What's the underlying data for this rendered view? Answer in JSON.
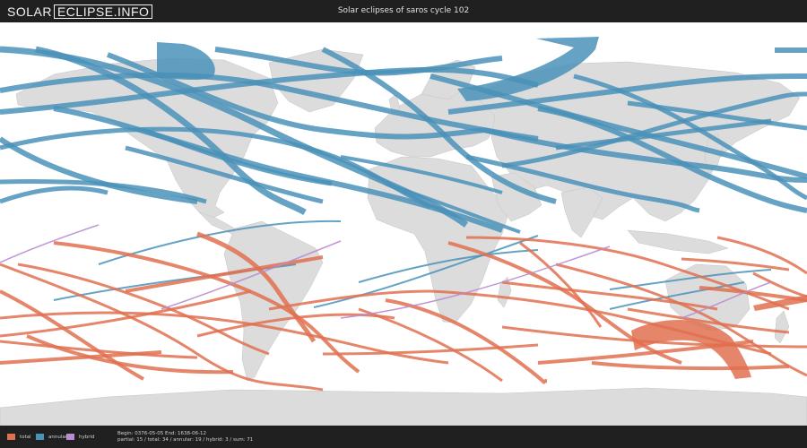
{
  "header": {
    "logo_left": "SOLAR",
    "logo_box": "ECLIPSE.INFO",
    "title": "Solar eclipses of saros cycle 102"
  },
  "legend": {
    "total": {
      "label": "total",
      "color": "#e07050"
    },
    "annular": {
      "label": "annular",
      "color": "#4a92b8"
    },
    "hybrid": {
      "label": "hybrid",
      "color": "#b88cd0"
    }
  },
  "stats": {
    "line1": "Begin: 0376-05-05 End: 1638-06-12",
    "line2": "partial: 15 / total: 34 / annular: 19 / hybrid: 3 / sum: 71"
  },
  "colors": {
    "land": "#dcdcdc",
    "ocean": "#ffffff",
    "bar": "#202020"
  }
}
